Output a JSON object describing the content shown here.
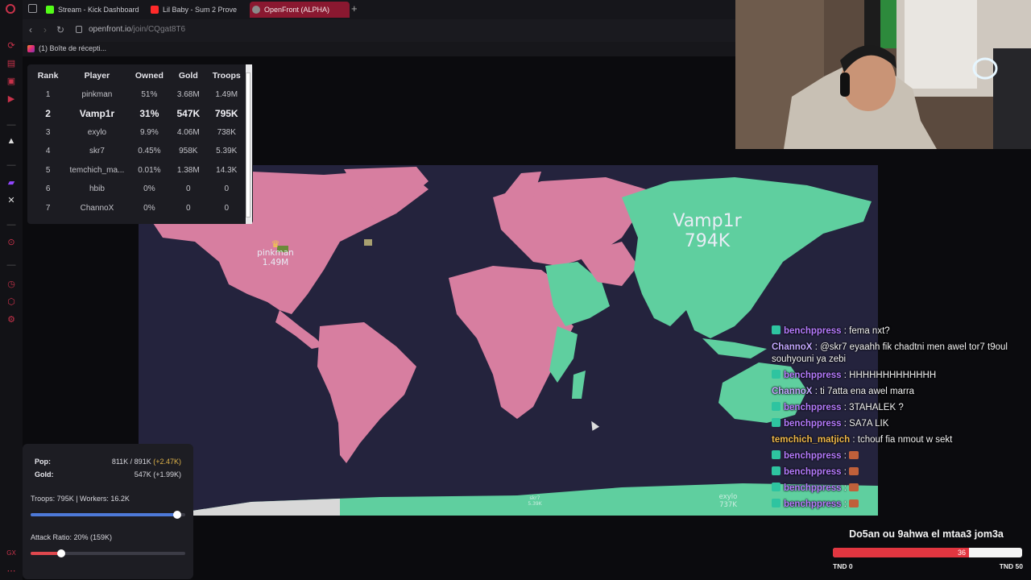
{
  "browser": {
    "tabs": [
      {
        "label": "Stream - Kick Dashboard",
        "color": "#53fc18"
      },
      {
        "label": "Lil Baby - Sum 2 Prove",
        "color": "#ff2a2a"
      },
      {
        "label": "OpenFront (ALPHA)",
        "color": "#8a8a8a"
      }
    ],
    "new_tab": "+",
    "url_host": "openfront.io",
    "url_path": "/join/CQgat8T6",
    "bookmark": "(1) Boîte de récepti..."
  },
  "leaderboard": {
    "headers": [
      "Rank",
      "Player",
      "Owned",
      "Gold",
      "Troops"
    ],
    "rows": [
      {
        "rank": "1",
        "player": "pinkman",
        "owned": "51%",
        "gold": "3.68M",
        "troops": "1.49M"
      },
      {
        "rank": "2",
        "player": "Vamp1r",
        "owned": "31%",
        "gold": "547K",
        "troops": "795K"
      },
      {
        "rank": "3",
        "player": "exylo",
        "owned": "9.9%",
        "gold": "4.06M",
        "troops": "738K"
      },
      {
        "rank": "4",
        "player": "skr7",
        "owned": "0.45%",
        "gold": "958K",
        "troops": "5.39K"
      },
      {
        "rank": "5",
        "player": "temchich_ma...",
        "owned": "0.01%",
        "gold": "1.38M",
        "troops": "14.3K"
      },
      {
        "rank": "6",
        "player": "hbib",
        "owned": "0%",
        "gold": "0",
        "troops": "0"
      },
      {
        "rank": "7",
        "player": "ChannoX",
        "owned": "0%",
        "gold": "0",
        "troops": "0"
      }
    ]
  },
  "map": {
    "labels": {
      "pinkman_name": "pinkman",
      "pinkman_troops": "1.49M",
      "vamp_name": "Vamp1r",
      "vamp_troops": "794K",
      "exylo_name": "exylo",
      "exylo_troops": "737K",
      "skr_name": "skr7",
      "skr_troops": "5.39K"
    },
    "colors": {
      "ocean": "#24233d",
      "pinkman": "#d77ea0",
      "vamp": "#5fcf9f",
      "ice": "#d8d8d8"
    }
  },
  "chat": {
    "messages": [
      {
        "user": "benchppress",
        "text": ": fema nxt?",
        "badge": true,
        "cls": "u1"
      },
      {
        "user": "ChannoX",
        "text": ": @skr7 eyaahh fik chadtni men awel tor7 t9oul souhyouni ya zebi",
        "badge": false,
        "cls": "u2"
      },
      {
        "user": "benchppress",
        "text": ": HHHHHHHHHHHHH",
        "badge": true,
        "cls": "u1"
      },
      {
        "user": "ChannoX",
        "text": ": ti 7atta ena awel marra",
        "badge": false,
        "cls": "u2"
      },
      {
        "user": "benchppress",
        "text": ": 3TAHALEK ?",
        "badge": true,
        "cls": "u1"
      },
      {
        "user": "benchppress",
        "text": ": SA7A LIK",
        "badge": true,
        "cls": "u1"
      },
      {
        "user": "temchich_matjich",
        "text": ": tchouf fia nmout w sekt",
        "badge": false,
        "cls": "u3"
      },
      {
        "user": "benchppress",
        "text": ":",
        "badge": true,
        "cls": "u1",
        "emote": true
      },
      {
        "user": "benchppress",
        "text": ":",
        "badge": true,
        "cls": "u1",
        "emote": true
      },
      {
        "user": "benchppress",
        "text": ":",
        "badge": true,
        "cls": "u1",
        "emote": true
      },
      {
        "user": "benchppress",
        "text": ":",
        "badge": true,
        "cls": "u1",
        "emote": true
      }
    ]
  },
  "goal": {
    "title": "Do5an ou 9ahwa el mtaa3 jom3a",
    "current": "36",
    "min": "TND 0",
    "max": "TND 50",
    "progress": 0.72
  },
  "controls": {
    "pop_label": "Pop:",
    "pop_value": "811K / 891K",
    "pop_delta": "(+2.47K)",
    "gold_label": "Gold:",
    "gold_value": "547K (+1.99K)",
    "troops_text": "Troops: 795K | Workers: 16.2K",
    "troops_ratio": 0.95,
    "attack_text": "Attack Ratio: 20% (159K)",
    "attack_ratio": 0.2
  }
}
